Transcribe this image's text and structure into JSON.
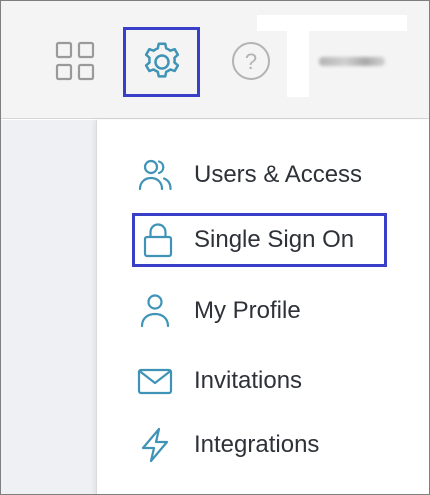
{
  "toolbar": {
    "apps_icon": "grid-apps-icon",
    "settings_icon": "gear-icon",
    "help_icon": "help-icon",
    "help_glyph": "?",
    "user_name": "",
    "highlight_color": "#3a3fc9"
  },
  "menu": {
    "items": [
      {
        "label": "Users & Access",
        "icon": "users-icon"
      },
      {
        "label": "Single Sign On",
        "icon": "lock-icon",
        "highlighted": true
      },
      {
        "label": "My Profile",
        "icon": "user-icon"
      },
      {
        "label": "Invitations",
        "icon": "envelope-icon"
      },
      {
        "label": "Integrations",
        "icon": "lightning-icon"
      }
    ],
    "icon_color": "#3f93b7"
  }
}
